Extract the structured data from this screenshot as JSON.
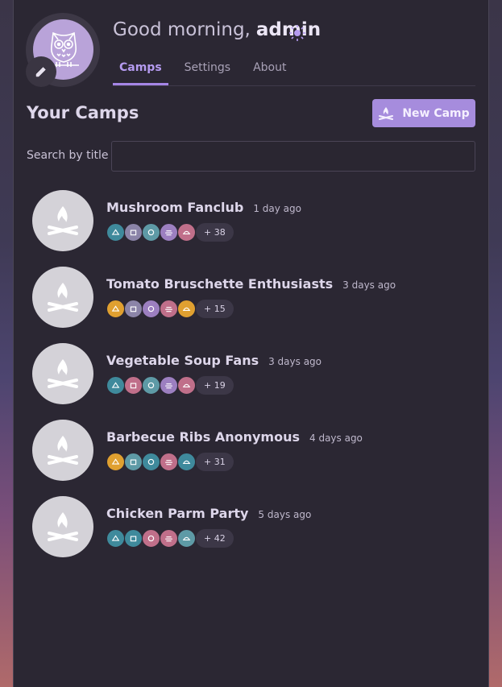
{
  "header": {
    "greeting": "Good morning,",
    "username": "admin",
    "avatar_icon": "owl-icon",
    "edit_icon": "pencil-icon",
    "theme_icon": "sun-icon"
  },
  "tabs": [
    {
      "label": "Camps",
      "active": true
    },
    {
      "label": "Settings",
      "active": false
    },
    {
      "label": "About",
      "active": false
    }
  ],
  "section_title": "Your Camps",
  "new_camp_label": "New Camp",
  "search": {
    "label": "Search by title",
    "value": "",
    "placeholder": ""
  },
  "camps": [
    {
      "title": "Mushroom Fanclub",
      "time": "1 day ago",
      "more": "+ 38",
      "members": [
        "#3f8a9c",
        "#8b84a8",
        "#5e9aa6",
        "#9c7fc0",
        "#c06f8a"
      ]
    },
    {
      "title": "Tomato Bruschette Enthusiasts",
      "time": "3 days ago",
      "more": "+ 15",
      "members": [
        "#e0a030",
        "#8b84a8",
        "#9c7fc0",
        "#c06f8a",
        "#e0a030"
      ]
    },
    {
      "title": "Vegetable Soup Fans",
      "time": "3 days ago",
      "more": "+ 19",
      "members": [
        "#3f8a9c",
        "#c06f8a",
        "#5e9aa6",
        "#9c7fc0",
        "#c06f8a"
      ]
    },
    {
      "title": "Barbecue Ribs Anonymous",
      "time": "4 days ago",
      "more": "+ 31",
      "members": [
        "#e0a030",
        "#5e9aa6",
        "#3f8a9c",
        "#c06f8a",
        "#3f8a9c"
      ]
    },
    {
      "title": "Chicken Parm Party",
      "time": "5 days ago",
      "more": "+ 42",
      "members": [
        "#3f8a9c",
        "#3f8a9c",
        "#c06f8a",
        "#c06f8a",
        "#5e9aa6"
      ]
    }
  ],
  "colors": {
    "accent": "#a68cdd",
    "panel": "#2b2733",
    "camp_bg": "#d4d2d8"
  }
}
